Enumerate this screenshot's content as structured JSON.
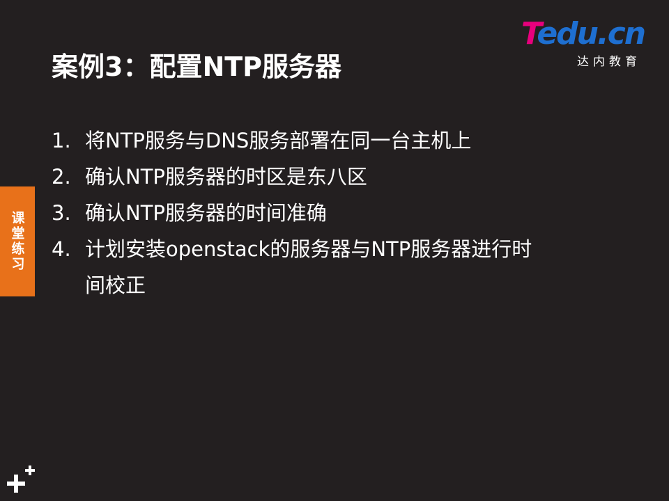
{
  "slide": {
    "title": "案例3：配置NTP服务器",
    "side_tab": "课堂练习",
    "items": [
      {
        "num": "1.",
        "text": "将NTP服务与DNS服务部署在同一台主机上"
      },
      {
        "num": "2.",
        "text": "确认NTP服务器的时区是东八区"
      },
      {
        "num": "3.",
        "text": "确认NTP服务器的时间准确"
      },
      {
        "num": "4.",
        "text": "计划安装openstack的服务器与NTP服务器进行时\n间校正"
      }
    ]
  },
  "logo": {
    "brand_t": "T",
    "brand_rest": "edu.cn",
    "sub": "达内教育",
    "colors": {
      "t": "#e8007d",
      "rest": "#1e6fd1"
    }
  },
  "icons": {
    "corner": "plus-plus-icon"
  },
  "colors": {
    "background": "#231f20",
    "accent": "#e8711a",
    "text": "#ffffff"
  }
}
